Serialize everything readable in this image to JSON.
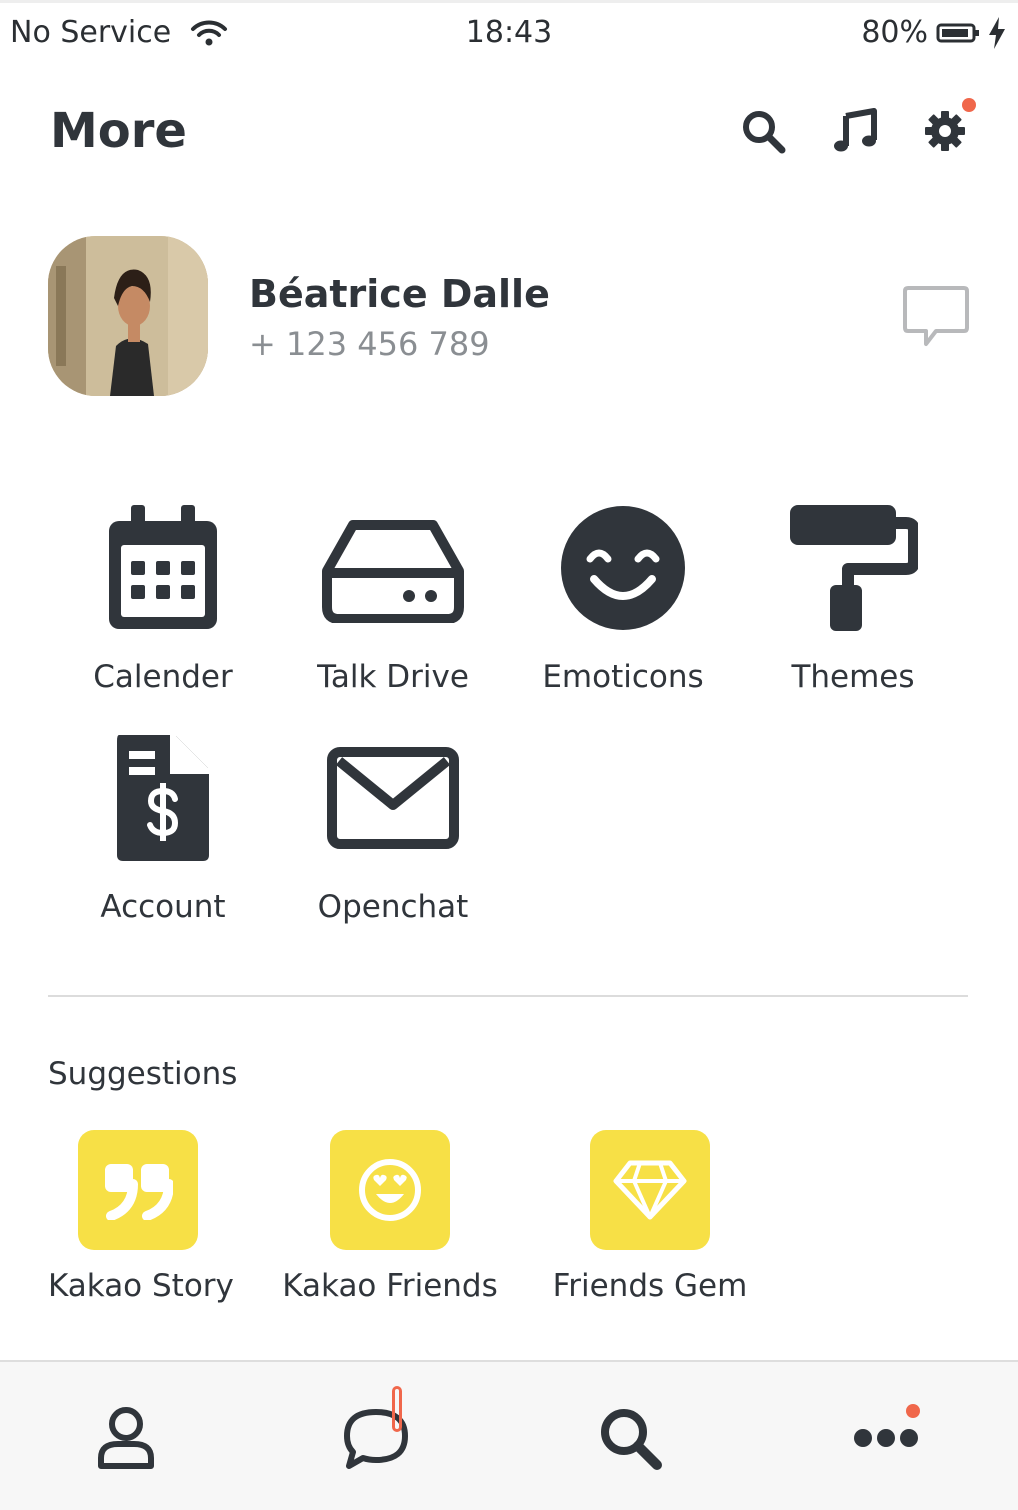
{
  "status_bar": {
    "carrier": "No Service",
    "time": "18:43",
    "battery": "80%"
  },
  "header": {
    "title": "More",
    "icons": [
      "search-icon",
      "music-note-icon",
      "gear-icon"
    ]
  },
  "profile": {
    "name": "Béatrice Dalle",
    "phone": "+ 123 456 789"
  },
  "menu": [
    {
      "label": "Calender",
      "icon": "calendar-icon"
    },
    {
      "label": "Talk Drive",
      "icon": "drive-icon"
    },
    {
      "label": "Emoticons",
      "icon": "smiley-icon"
    },
    {
      "label": "Themes",
      "icon": "paint-roller-icon"
    },
    {
      "label": "Account",
      "icon": "invoice-icon"
    },
    {
      "label": "Openchat",
      "icon": "envelope-icon"
    }
  ],
  "suggestions": {
    "title": "Suggestions",
    "items": [
      {
        "label": "Kakao Story",
        "icon": "quote-icon"
      },
      {
        "label": "Kakao Friends",
        "icon": "heart-eyes-icon"
      },
      {
        "label": "Friends Gem",
        "icon": "diamond-icon"
      }
    ]
  },
  "tabbar": {
    "tabs": [
      "person-icon",
      "chat-icon",
      "search-icon",
      "more-dots-icon"
    ]
  },
  "colors": {
    "accent_yellow": "#f7e046",
    "badge": "#f0674b",
    "icon": "#30353b"
  }
}
